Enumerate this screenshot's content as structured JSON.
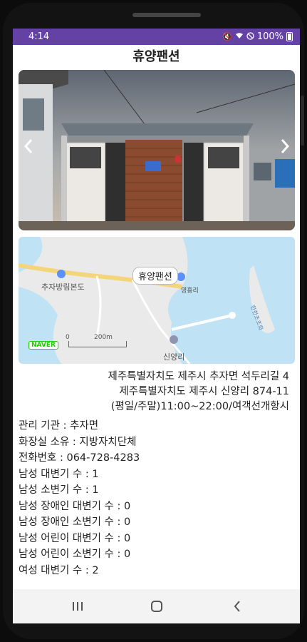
{
  "status": {
    "time": "4:14",
    "battery": "100%"
  },
  "header": {
    "title": "휴양팬션"
  },
  "map": {
    "place_label": "휴양팬션",
    "labels": [
      "추자방림본도",
      "신양리",
      "영흥리",
      "한한초초화"
    ],
    "logo": "NAVER",
    "scale_start": "0",
    "scale_end": "200m"
  },
  "address": {
    "road": "제주특별자치도 제주시 추자면 석두리길 4",
    "lot": "제주특별자치도 제주시 신양리 874-11",
    "hours": "(평일/주말)11:00~22:00/여객선개항시"
  },
  "details": [
    "관리 기관 : 추자면",
    "화장실 소유 : 지방자치단체",
    "전화번호 : 064-728-4283",
    "남성 대변기 수 : 1",
    "남성 소변기 수 : 1",
    "남성 장애인 대변기 수 : 0",
    "남성 장애인 소변기 수 : 0",
    "남성 어린이 대변기 수 : 0",
    "남성 어린이 소변기 수 : 0",
    "여성 대변기 수 : 2"
  ],
  "colors": {
    "statusbar": "#6441a5",
    "background": "#ffffff"
  },
  "icons": [
    "mute-icon",
    "wifi-icon",
    "no-disturb-icon",
    "battery-icon",
    "chevron-left-icon",
    "chevron-right-icon",
    "recents-icon",
    "home-icon",
    "back-icon"
  ]
}
